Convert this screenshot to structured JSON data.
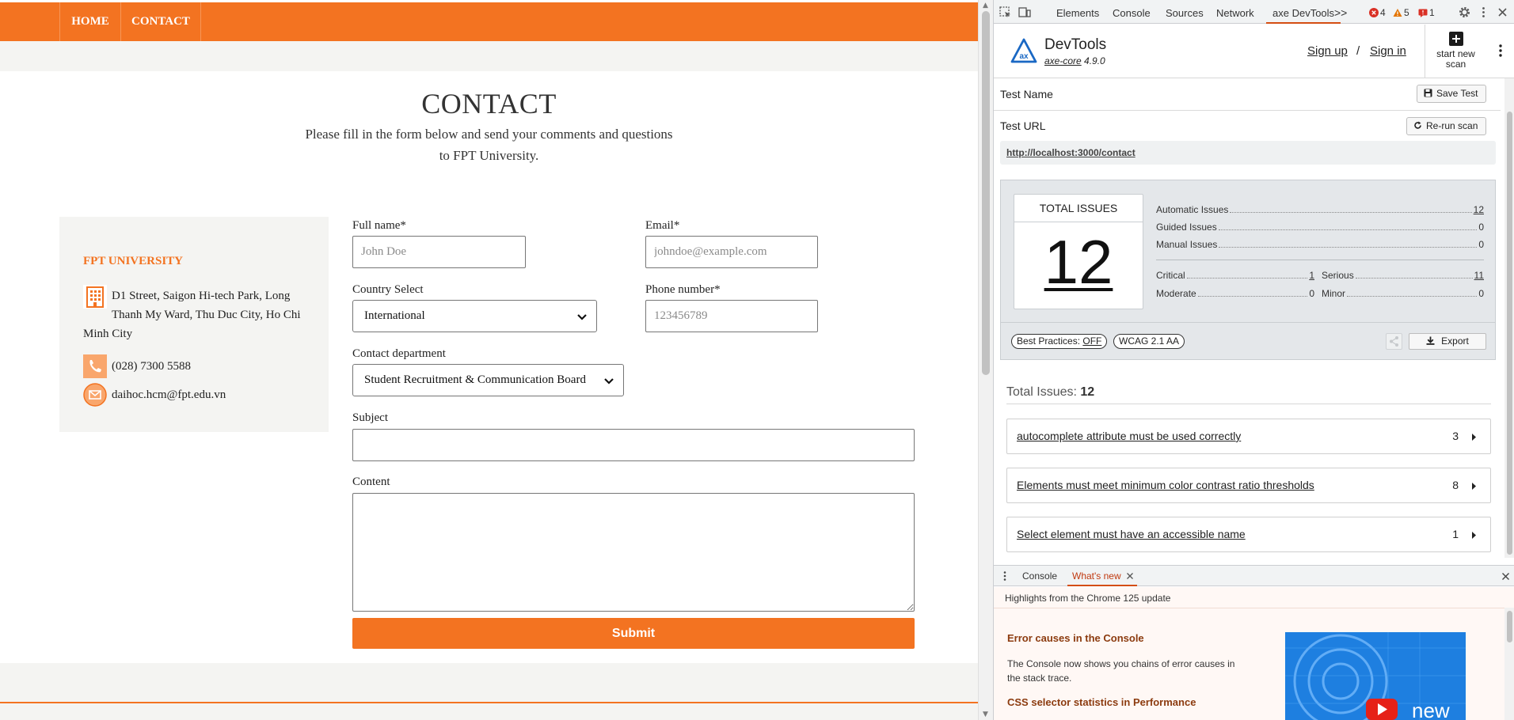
{
  "nav": {
    "home": "HOME",
    "contact": "CONTACT"
  },
  "header": {
    "title": "CONTACT",
    "subtitle_line1": "Please fill in the form below and send your comments and questions",
    "subtitle_line2": "to FPT University."
  },
  "info": {
    "name": "FPT UNIVERSITY",
    "address": "D1 Street, Saigon Hi-tech Park, Long Thanh My Ward, Thu Duc City, Ho Chi Minh City",
    "phone": "(028) 7300 5588",
    "email": "daihoc.hcm@fpt.edu.vn",
    "accent": "#f37321"
  },
  "form": {
    "fullname_label": "Full name*",
    "fullname_placeholder": "John Doe",
    "email_label": "Email*",
    "email_placeholder": "johndoe@example.com",
    "country_label": "Country Select",
    "country_value": "International",
    "phone_label": "Phone number*",
    "phone_placeholder": "123456789",
    "department_label": "Contact department",
    "department_value": "Student Recruitment & Communication Board",
    "subject_label": "Subject",
    "content_label": "Content",
    "submit": "Submit"
  },
  "devtools": {
    "tabs": [
      "Elements",
      "Console",
      "Sources",
      "Network",
      "axe DevTools"
    ],
    "more": ">>",
    "errors": "4",
    "warnings": "5",
    "issues": "1",
    "axe": {
      "title": "DevTools",
      "core_name": "axe-core",
      "core_version": "4.9.0",
      "signup": "Sign up",
      "slash": "/",
      "signin": "Sign in",
      "start_new_scan": "start new scan",
      "test_name_label": "Test Name",
      "save_test": "Save Test",
      "test_url_label": "Test URL",
      "rerun_scan": "Re-run scan",
      "url": "http://localhost:3000/contact",
      "total_issues_title": "TOTAL ISSUES",
      "total_issues": "12",
      "automatic_label": "Automatic Issues",
      "automatic": "12",
      "guided_label": "Guided Issues",
      "guided": "0",
      "manual_label": "Manual Issues",
      "manual": "0",
      "critical_label": "Critical",
      "critical": "1",
      "serious_label": "Serious",
      "serious": "11",
      "moderate_label": "Moderate",
      "moderate": "0",
      "minor_label": "Minor",
      "minor": "0",
      "best_practices_label": "Best Practices:",
      "best_practices_value": "OFF",
      "wcag": "WCAG 2.1 AA",
      "export": "Export",
      "total_issues_heading": "Total Issues:",
      "issue_rows": [
        {
          "title": "autocomplete attribute must be used correctly",
          "count": "3"
        },
        {
          "title": "Elements must meet minimum color contrast ratio thresholds",
          "count": "8"
        },
        {
          "title": "Select element must have an accessible name",
          "count": "1"
        }
      ]
    },
    "drawer": {
      "console_tab": "Console",
      "whatsnew_tab": "What's new",
      "highlights": "Highlights from the Chrome 125 update",
      "h1": "Error causes in the Console",
      "p1": "The Console now shows you chains of error causes in the stack trace.",
      "h2": "CSS selector statistics in Performance",
      "video_text": "new"
    }
  }
}
